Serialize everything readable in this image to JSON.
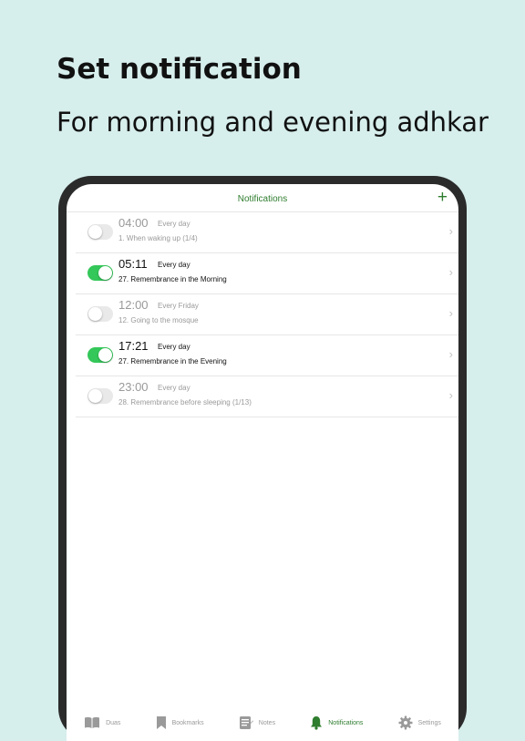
{
  "headline": "Set notification",
  "subline": "For morning and evening adhkar",
  "navbar": {
    "title": "Notifications",
    "add_icon": "plus-icon",
    "add_symbol": "+"
  },
  "notifications": [
    {
      "time": "04:00",
      "frequency": "Every day",
      "title": "1. When waking up (1/4)",
      "enabled": false
    },
    {
      "time": "05:11",
      "frequency": "Every day",
      "title": "27. Remembrance in the Morning",
      "enabled": true
    },
    {
      "time": "12:00",
      "frequency": "Every Friday",
      "title": "12. Going to the mosque",
      "enabled": false
    },
    {
      "time": "17:21",
      "frequency": "Every day",
      "title": "27. Remembrance in the Evening",
      "enabled": true
    },
    {
      "time": "23:00",
      "frequency": "Every day",
      "title": "28. Remembrance before sleeping (1/13)",
      "enabled": false
    }
  ],
  "chevron": "›",
  "tabs": [
    {
      "label": "Duas",
      "icon": "book-icon",
      "active": false
    },
    {
      "label": "Bookmarks",
      "icon": "bookmark-icon",
      "active": false
    },
    {
      "label": "Notes",
      "icon": "notes-icon",
      "active": false
    },
    {
      "label": "Notifications",
      "icon": "bell-icon",
      "active": true
    },
    {
      "label": "Settings",
      "icon": "gear-icon",
      "active": false
    }
  ],
  "colors": {
    "background": "#d6eeec",
    "accent": "#2f7d2f",
    "toggle_on": "#34c759",
    "toggle_off": "#e9e9ea",
    "device_frame": "#2b2b2b"
  }
}
